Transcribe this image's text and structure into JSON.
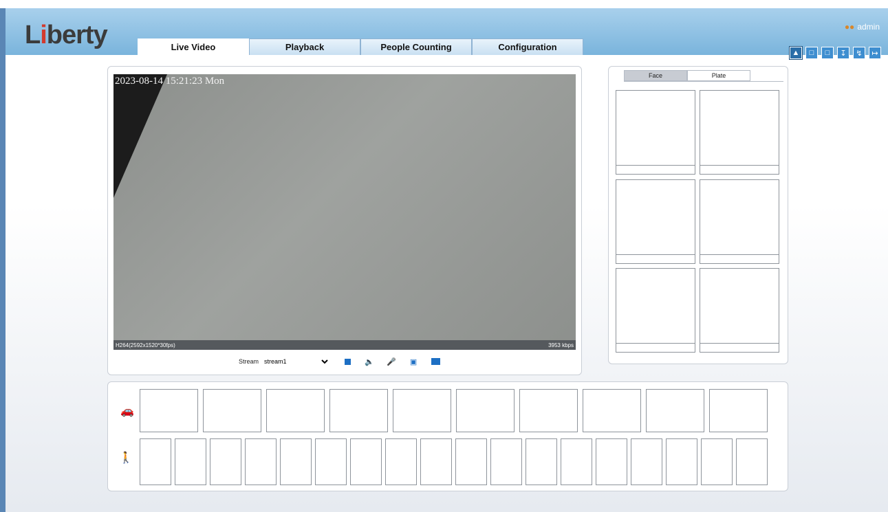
{
  "brand": {
    "name_start": "L",
    "name_dot": "i",
    "name_end": "berty"
  },
  "tabs": [
    {
      "label": "Live Video",
      "active": true
    },
    {
      "label": "Playback",
      "active": false
    },
    {
      "label": "People Counting",
      "active": false
    },
    {
      "label": "Configuration",
      "active": false
    }
  ],
  "user": {
    "name": "admin",
    "icon": "user-group-icon"
  },
  "toolbar_icons": [
    "live-alarm-icon",
    "record-icon",
    "snapshot-file-icon",
    "download-icon",
    "password-icon",
    "logout-icon"
  ],
  "video": {
    "osd_timestamp": "2023-08-14 15:21:23 Mon",
    "stream_info": "H264(2592x1520*30fps)",
    "bitrate": "3953 kbps"
  },
  "controls": {
    "stream_label": "Stream",
    "stream_value": "stream1",
    "stream_options": [
      "stream1"
    ],
    "icons": [
      "stop-icon",
      "audio-mute-icon",
      "mic-mute-icon",
      "snapshot-icon",
      "fullscreen-icon"
    ]
  },
  "side_tabs": [
    {
      "label": "Face",
      "active": true
    },
    {
      "label": "Plate",
      "active": false
    }
  ],
  "strip": {
    "vehicle_icon": "car-icon",
    "nonvehicle_icon": "pedestrian-bicycle-icon"
  },
  "colors": {
    "header": "#7ab4dc",
    "accent": "#1d6fc4",
    "frame": "#5a86b5"
  }
}
